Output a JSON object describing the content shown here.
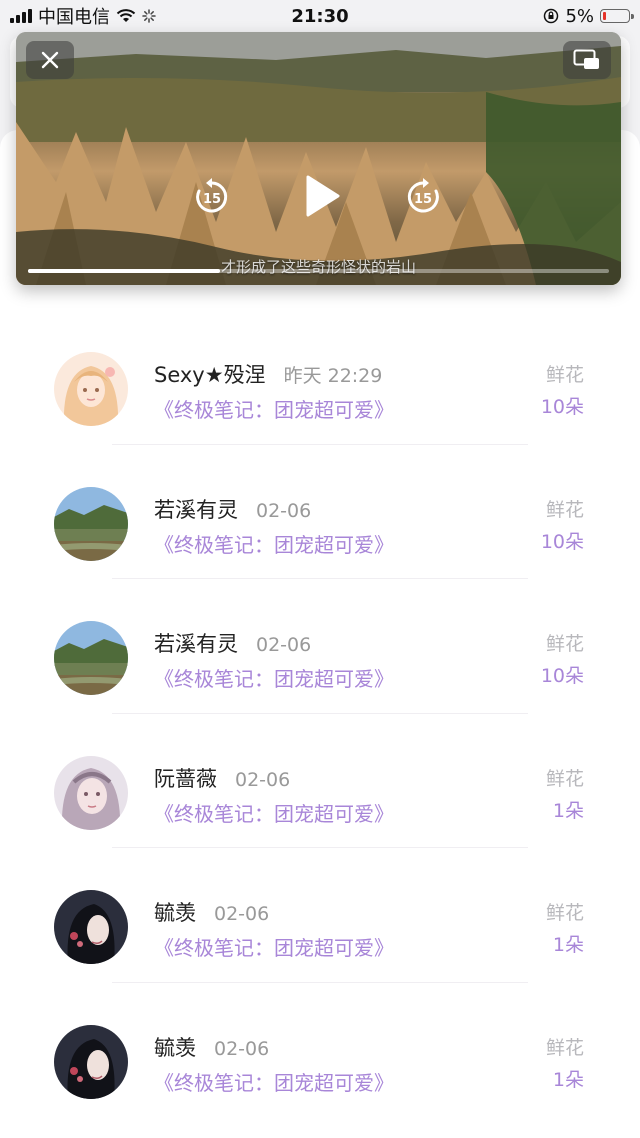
{
  "status_bar": {
    "carrier": "中国电信",
    "time": "21:30",
    "battery_percent": "5%"
  },
  "video": {
    "subtitle": "才形成了这些奇形怪状的岩山",
    "rewind_seconds": "15",
    "forward_seconds": "15",
    "progress": 0.33
  },
  "list": {
    "items": [
      {
        "name": "Sexy★殁涅",
        "time": "昨天 22:29",
        "book": "《终极笔记：团宠超可爱》",
        "gift_label": "鲜花",
        "gift_count": "10朵"
      },
      {
        "name": "若溪有灵",
        "time": "02-06",
        "book": "《终极笔记：团宠超可爱》",
        "gift_label": "鲜花",
        "gift_count": "10朵"
      },
      {
        "name": "若溪有灵",
        "time": "02-06",
        "book": "《终极笔记：团宠超可爱》",
        "gift_label": "鲜花",
        "gift_count": "10朵"
      },
      {
        "name": "阮蔷薇",
        "time": "02-06",
        "book": "《终极笔记：团宠超可爱》",
        "gift_label": "鲜花",
        "gift_count": "1朵"
      },
      {
        "name": "毓羡",
        "time": "02-06",
        "book": "《终极笔记：团宠超可爱》",
        "gift_label": "鲜花",
        "gift_count": "1朵"
      },
      {
        "name": "毓羡",
        "time": "02-06",
        "book": "《终极笔记：团宠超可爱》",
        "gift_label": "鲜花",
        "gift_count": "1朵"
      }
    ]
  },
  "icons": {
    "close": "close-icon",
    "pip": "picture-in-picture-icon",
    "rewind": "rewind-15-icon",
    "play": "play-icon",
    "forward": "forward-15-icon",
    "signal": "cellular-signal-icon",
    "wifi": "wifi-icon",
    "lock": "orientation-lock-icon",
    "battery": "battery-icon"
  },
  "colors": {
    "accent_purple": "#a886d8",
    "battery_low": "#e5332a"
  }
}
